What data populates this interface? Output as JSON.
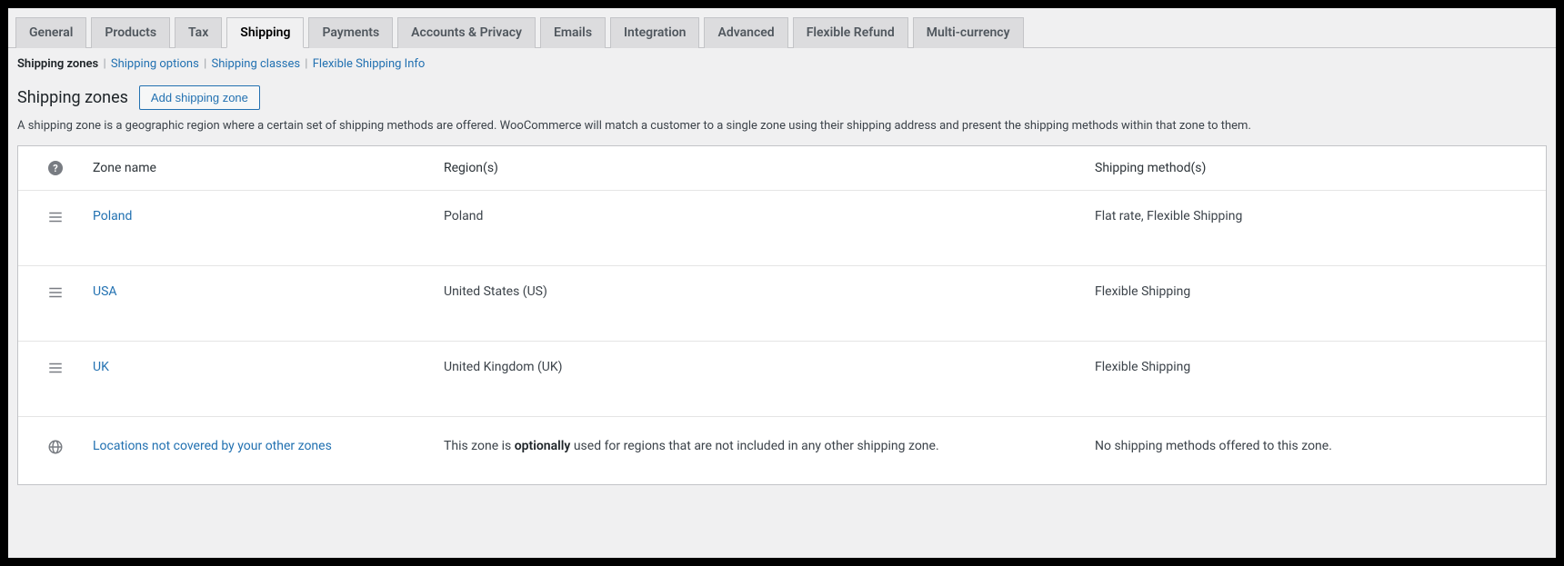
{
  "tabs": [
    {
      "label": "General"
    },
    {
      "label": "Products"
    },
    {
      "label": "Tax"
    },
    {
      "label": "Shipping",
      "active": true
    },
    {
      "label": "Payments"
    },
    {
      "label": "Accounts & Privacy"
    },
    {
      "label": "Emails"
    },
    {
      "label": "Integration"
    },
    {
      "label": "Advanced"
    },
    {
      "label": "Flexible Refund"
    },
    {
      "label": "Multi-currency"
    }
  ],
  "subnav": [
    {
      "label": "Shipping zones",
      "current": true
    },
    {
      "label": "Shipping options"
    },
    {
      "label": "Shipping classes"
    },
    {
      "label": "Flexible Shipping Info"
    }
  ],
  "page_title": "Shipping zones",
  "add_button_label": "Add shipping zone",
  "description": "A shipping zone is a geographic region where a certain set of shipping methods are offered. WooCommerce will match a customer to a single zone using their shipping address and present the shipping methods within that zone to them.",
  "columns": {
    "zone_name": "Zone name",
    "regions": "Region(s)",
    "methods": "Shipping method(s)"
  },
  "zones": [
    {
      "name": "Poland",
      "regions": "Poland",
      "methods": "Flat rate, Flexible Shipping"
    },
    {
      "name": "USA",
      "regions": "United States (US)",
      "methods": "Flexible Shipping"
    },
    {
      "name": "UK",
      "regions": "United Kingdom (UK)",
      "methods": "Flexible Shipping"
    }
  ],
  "fallback": {
    "name": "Locations not covered by your other zones",
    "desc_pre": "This zone is ",
    "desc_bold": "optionally",
    "desc_post": " used for regions that are not included in any other shipping zone.",
    "methods": "No shipping methods offered to this zone."
  }
}
